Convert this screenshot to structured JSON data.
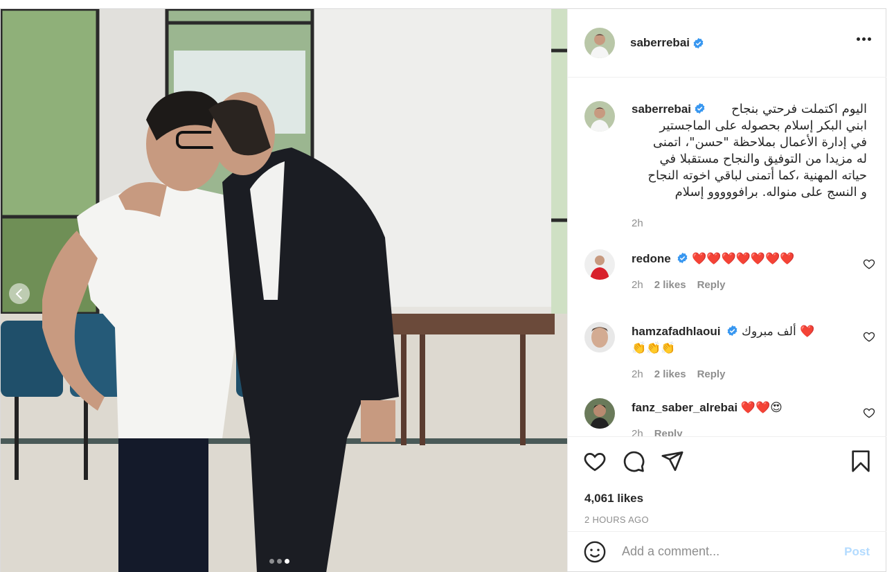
{
  "post": {
    "author": "saberrebai",
    "caption_text": "اليوم اكتملت فرحتي بنجاح\nابني البكر إسلام بحصوله على الماجستير\nفي إدارة الأعمال بملاحظة \"حسن\"، اتمنى\nله مزيدا من التوفيق والنجاح مستقبلا في\nحياته المهنية ،كما أتمنى لباقي اخوته النجاح\nو النسج على منواله. برافووووو إسلام",
    "caption_time": "2h",
    "likes": "4,061 likes",
    "time_ago": "2 HOURS AGO",
    "carousel": {
      "count": 3,
      "active_index": 3
    }
  },
  "comments": [
    {
      "user": "redone",
      "verified": true,
      "text": "❤️❤️❤️❤️❤️❤️❤️",
      "time": "2h",
      "likes": "2 likes",
      "reply": "Reply"
    },
    {
      "user": "hamzafadhlaoui",
      "verified": true,
      "text": "ألف مبروك ❤️",
      "text2": "👏👏👏",
      "time": "2h",
      "likes": "2 likes",
      "reply": "Reply"
    },
    {
      "user": "fanz_saber_alrebai",
      "verified": false,
      "text": "❤️❤️😍",
      "time": "2h",
      "likes": "",
      "reply": "Reply"
    }
  ],
  "add_comment": {
    "placeholder": "Add a comment...",
    "post_label": "Post"
  },
  "icons": [
    "more-options-icon",
    "verified-badge-icon",
    "heart-icon",
    "comment-icon",
    "share-icon",
    "bookmark-icon",
    "emoji-icon",
    "carousel-prev-icon"
  ],
  "colors": {
    "verified": "#3897f0",
    "post_button_disabled": "#b3dbff",
    "muted_text": "#8e8e8e",
    "heart_emoji": "#e0153a"
  }
}
